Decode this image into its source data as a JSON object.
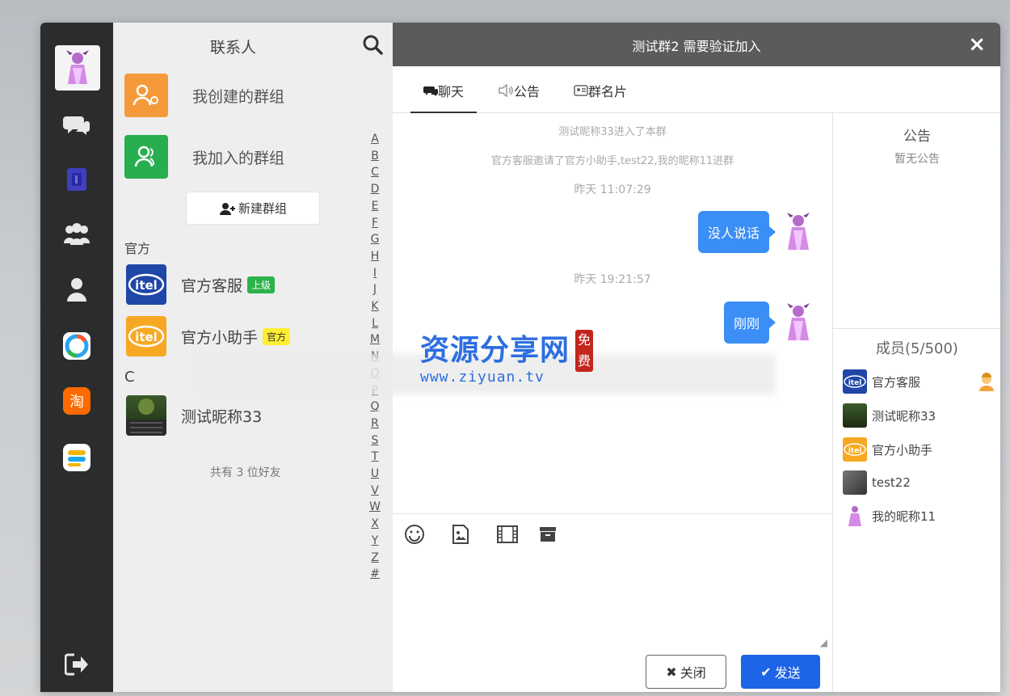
{
  "contacts": {
    "title": "联系人",
    "groups": [
      {
        "label": "我创建的群组",
        "color": "#f59a3a"
      },
      {
        "label": "我加入的群组",
        "color": "#27ae4f"
      }
    ],
    "new_group_label": "新建群组",
    "section_official": "官方",
    "friends_official": [
      {
        "name": "官方客服",
        "badge": "上级"
      },
      {
        "name": "官方小助手",
        "badge": "官方"
      }
    ],
    "section_c": "C",
    "friends_c": [
      {
        "name": "测试昵称33"
      }
    ],
    "alphabet": [
      "A",
      "B",
      "C",
      "D",
      "E",
      "F",
      "G",
      "H",
      "I",
      "J",
      "K",
      "L",
      "M",
      "N",
      "O",
      "P",
      "Q",
      "R",
      "S",
      "T",
      "U",
      "V",
      "W",
      "X",
      "Y",
      "Z",
      "#"
    ],
    "friend_count": "共有 3 位好友"
  },
  "chat": {
    "title": "测试群2 需要验证加入",
    "close_glyph": "×",
    "tabs": [
      "聊天",
      "公告",
      "群名片"
    ],
    "system_messages": [
      "测试昵称33进入了本群",
      "官方客服邀请了官方小助手,test22,我的昵称11进群"
    ],
    "timestamps": [
      "昨天 11:07:29",
      "昨天 19:21:57"
    ],
    "messages": [
      "没人说话",
      "刚刚"
    ],
    "buttons": {
      "close": "关闭",
      "send": "发送"
    }
  },
  "side": {
    "notice_title": "公告",
    "notice_empty": "暂无公告",
    "members_title": "成员(5/500)",
    "members": [
      "官方客服",
      "测试昵称33",
      "官方小助手",
      "test22",
      "我的昵称11"
    ]
  },
  "watermark": {
    "brand": "资源分享网",
    "url": "www.ziyuan.tv",
    "seal": "免费"
  }
}
